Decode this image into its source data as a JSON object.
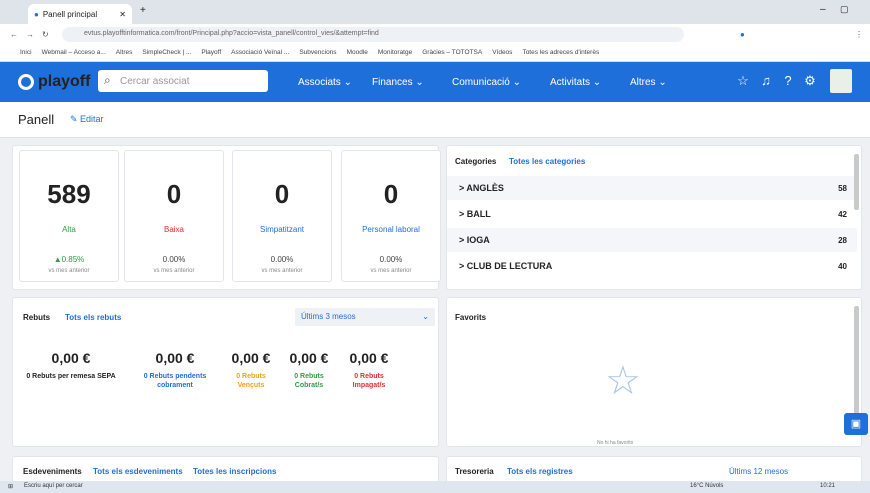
{
  "browser": {
    "tab_title": "Panell principal",
    "url": "evtus.playofftinformatica.com/front/Principal.php?accio=vista_panell/control_vies/&attempt=find",
    "bookmarks": [
      "Inici",
      "Webmail – Acceso a...",
      "Altres",
      "SimpleCheck | ...",
      "Playoff",
      "Associació Veïnal ...",
      "Subvencions",
      "Moodle",
      "Monitoratge",
      "Gràcies – TOTOTSA",
      "Vídeos",
      "Totes les adreces d'interès"
    ]
  },
  "app": {
    "logo": "playoff",
    "search_placeholder": "Cercar associat",
    "nav": [
      "Associats",
      "Finances",
      "Comunicació",
      "Activitats",
      "Altres"
    ]
  },
  "page": {
    "title": "Panell",
    "edit_label": "Editar"
  },
  "stats": [
    {
      "value": "589",
      "label": "Alta",
      "label_color": "#2e9e44",
      "pct": "▲0.85%",
      "pct_color": "#2e9e44",
      "cmp": "vs mes anterior"
    },
    {
      "value": "0",
      "label": "Baixa",
      "label_color": "#d93030",
      "pct": "0.00%",
      "pct_color": "#444",
      "cmp": "vs mes anterior"
    },
    {
      "value": "0",
      "label": "Simpatitzant",
      "label_color": "#1e6fd9",
      "pct": "0.00%",
      "pct_color": "#444",
      "cmp": "vs mes anterior"
    },
    {
      "value": "0",
      "label": "Personal laboral",
      "label_color": "#1e6fd9",
      "pct": "0.00%",
      "pct_color": "#444",
      "cmp": "vs mes anterior"
    }
  ],
  "categories": {
    "title": "Categories",
    "link": "Totes les categories",
    "items": [
      {
        "name": "> ANGLÈS",
        "count": "58"
      },
      {
        "name": "> BALL",
        "count": "42"
      },
      {
        "name": "> IOGA",
        "count": "28"
      },
      {
        "name": "> CLUB DE LECTURA",
        "count": "40"
      }
    ]
  },
  "rebuts": {
    "title": "Rebuts",
    "link": "Tots els rebuts",
    "period": "Últims 3 mesos",
    "items": [
      {
        "amount": "0,00 €",
        "label": "0 Rebuts per remesa SEPA",
        "color": "#222"
      },
      {
        "amount": "0,00 €",
        "label": "0 Rebuts pendents cobrament",
        "color": "#1e6fd9"
      },
      {
        "amount": "0,00 €",
        "label": "0 Rebuts Vençuts",
        "color": "#f0a020"
      },
      {
        "amount": "0,00 €",
        "label": "0 Rebuts Cobrat/s",
        "color": "#2e9e44"
      },
      {
        "amount": "0,00 €",
        "label": "0 Rebuts Impagat/s",
        "color": "#d93030"
      }
    ]
  },
  "favorits": {
    "title": "Favorits",
    "empty": "No hi ha favorits"
  },
  "esdeveniments": {
    "title": "Esdeveniments",
    "link1": "Tots els esdeveniments",
    "link2": "Totes les inscripcions"
  },
  "tresoreria": {
    "title": "Tresoreria",
    "link": "Tots els registres",
    "period": "Últims 12 mesos"
  },
  "taskbar": {
    "search": "Escriu aquí per cercar",
    "weather": "16°C Núvols",
    "time": "10:21"
  }
}
